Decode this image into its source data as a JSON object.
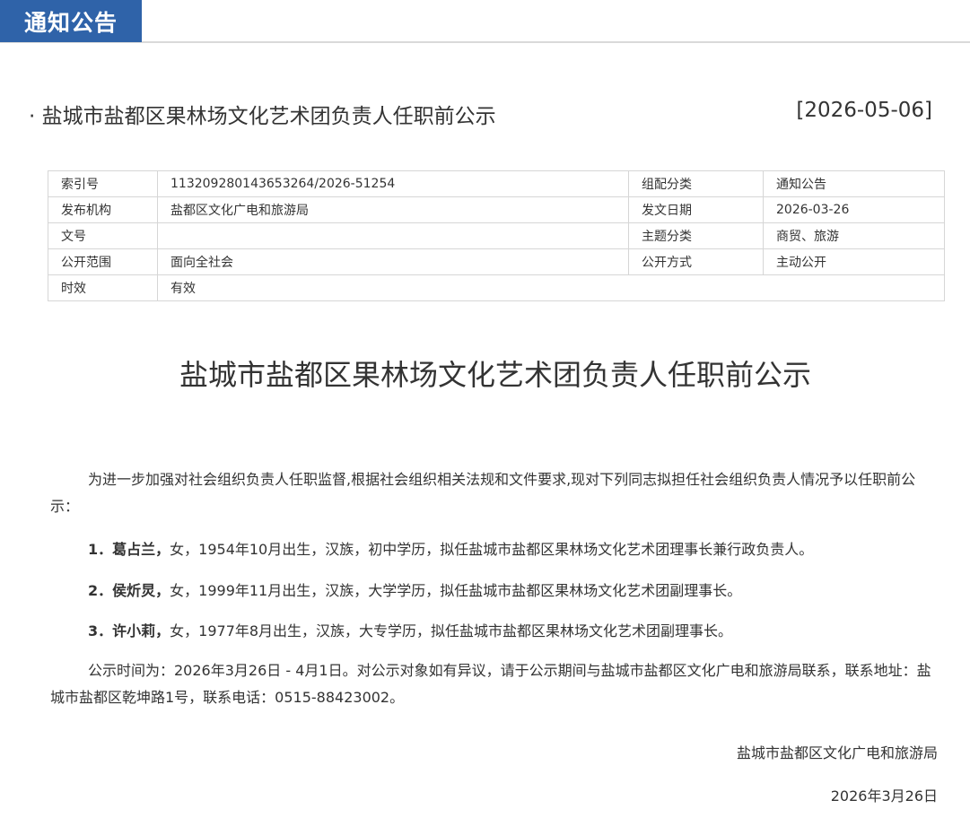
{
  "header": {
    "tab_label": "通知公告"
  },
  "notice": {
    "title": "· 盐城市盐都区果林场文化艺术团负责人任职前公示",
    "date": "[2026-05-06]"
  },
  "meta": {
    "rows": [
      [
        "索引号",
        "113209280143653264/2026-51254",
        "组配分类",
        "通知公告"
      ],
      [
        "发布机构",
        "盐都区文化广电和旅游局",
        "发文日期",
        "2026-03-26"
      ],
      [
        "文号",
        "",
        "主题分类",
        "商贸、旅游"
      ],
      [
        "公开范围",
        "面向全社会",
        "公开方式",
        "主动公开"
      ],
      [
        "时效",
        "有效"
      ]
    ]
  },
  "article": {
    "title": "盐城市盐都区果林场文化艺术团负责人任职前公示",
    "intro": "为进一步加强对社会组织负责人任职监督,根据社会组织相关法规和文件要求,现对下列同志拟担任社会组织负责人情况予以任职前公示：",
    "items": [
      {
        "num": "1．",
        "name": "葛占兰，",
        "text": "女，1954年10月出生，汉族，初中学历，拟任盐城市盐都区果林场文化艺术团理事长兼行政负责人。"
      },
      {
        "num": "2．",
        "name": "侯炘炅，",
        "text": "女，1999年11月出生，汉族，大学学历，拟任盐城市盐都区果林场文化艺术团副理事长。"
      },
      {
        "num": "3．",
        "name": "许小莉，",
        "text": "女，1977年8月出生，汉族，大专学历，拟任盐城市盐都区果林场文化艺术团副理事长。"
      }
    ],
    "closing": "公示时间为：2026年3月26日 - 4月1日。对公示对象如有异议，请于公示期间与盐城市盐都区文化广电和旅游局联系，联系地址：盐城市盐都区乾坤路1号，联系电话：0515-88423002。",
    "signature": "盐城市盐都区文化广电和旅游局",
    "sign_date": "2026年3月26日"
  }
}
